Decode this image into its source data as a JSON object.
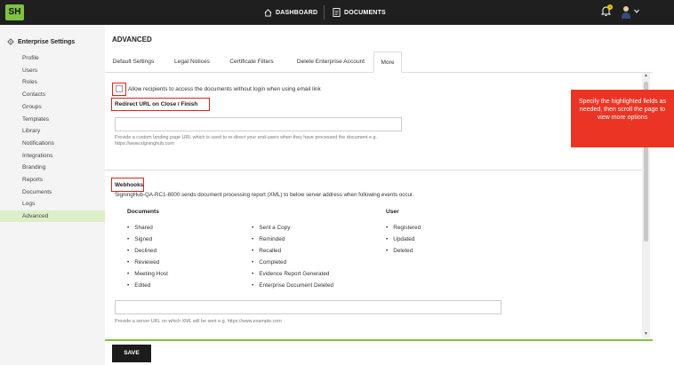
{
  "topbar": {
    "logo": "SH",
    "dashboard_label": "DASHBOARD",
    "documents_label": "DOCUMENTS",
    "notification_count": "1"
  },
  "sidebar": {
    "title": "Enterprise Settings",
    "items": [
      "Profile",
      "Users",
      "Roles",
      "Contacts",
      "Groups",
      "Templates",
      "Library",
      "Notifications",
      "Integrations",
      "Branding",
      "Reports",
      "Documents",
      "Logs",
      "Advanced"
    ],
    "active": "Advanced"
  },
  "main": {
    "title": "ADVANCED",
    "tabs": [
      "Default Settings",
      "Legal Notices",
      "Certificate Filters",
      "Delete Enterprise Account",
      "More"
    ],
    "active_tab": "More"
  },
  "content": {
    "allow_label": "Allow recipients to access the documents without login when using email link",
    "redirect_heading": "Redirect URL on Close / Finish",
    "redirect_value": "",
    "redirect_help_1": "Provide a custom landing page URL which is used to re-direct your end-users when they have processed the document e.g.",
    "redirect_help_2": "https://www.signinghub.com",
    "webhooks_heading": "Webhooks",
    "webhooks_desc": "SigningHub-QA-RC1-8000 sends document processing report (XML) to below server address when following events occur.",
    "documents_col_title": "Documents",
    "user_col_title": "User",
    "documents_events_col1": [
      "Shared",
      "Signed",
      "Declined",
      "Reviewed",
      "Meeting Host",
      "Edited"
    ],
    "documents_events_col2": [
      "Sent a Copy",
      "Reminded",
      "Recalled",
      "Completed",
      "Evidence Report Generated",
      "Enterprise Document Deleted"
    ],
    "user_events": [
      "Registered",
      "Updated",
      "Deleted"
    ],
    "webhook_url_value": "",
    "webhook_help": "Provide a server URL on which XML will be sent e.g. https://www.example.com"
  },
  "footer": {
    "save_label": "SAVE"
  },
  "callout": {
    "text": "Specify the highlighted fields as needed, then scroll the page to view more options"
  },
  "colors": {
    "brand_green": "#7ec242",
    "topbar": "#1f1f1f",
    "highlight_red": "#e0231b",
    "callout_red": "#ec3424",
    "active_side": "#ddefc9"
  }
}
